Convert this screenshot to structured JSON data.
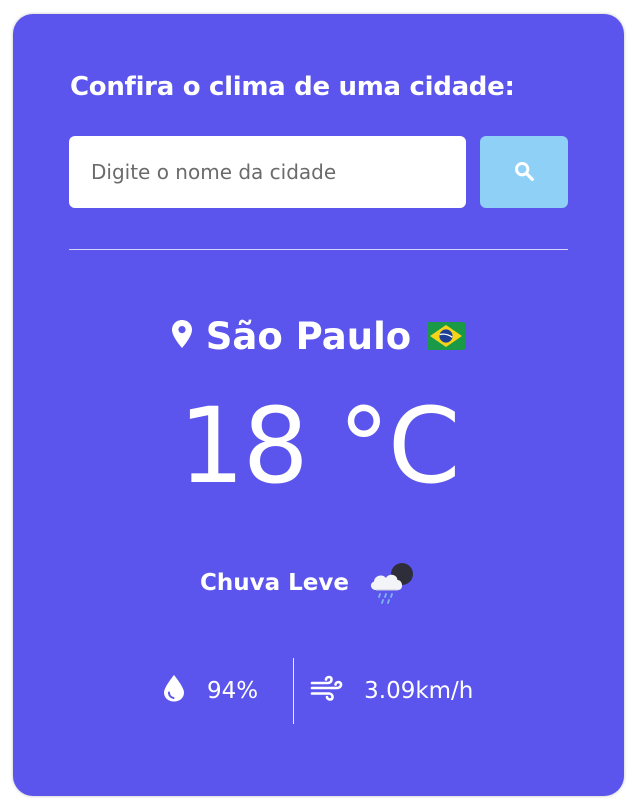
{
  "heading": "Confira o clima de uma cidade:",
  "search": {
    "placeholder": "Digite o nome da cidade",
    "value": "",
    "button_icon": "search-icon",
    "button_color": "#8fd0f7"
  },
  "weather": {
    "city": "São Paulo",
    "country_flag": "BR",
    "temperature": "18 °C",
    "description": "Chuva Leve",
    "condition_icon": "light-rain-icon",
    "humidity": "94%",
    "humidity_icon": "droplet-icon",
    "wind": "3.09km/h",
    "wind_icon": "wind-icon"
  },
  "colors": {
    "card_background": "#5b55ee",
    "text": "#ffffff"
  }
}
